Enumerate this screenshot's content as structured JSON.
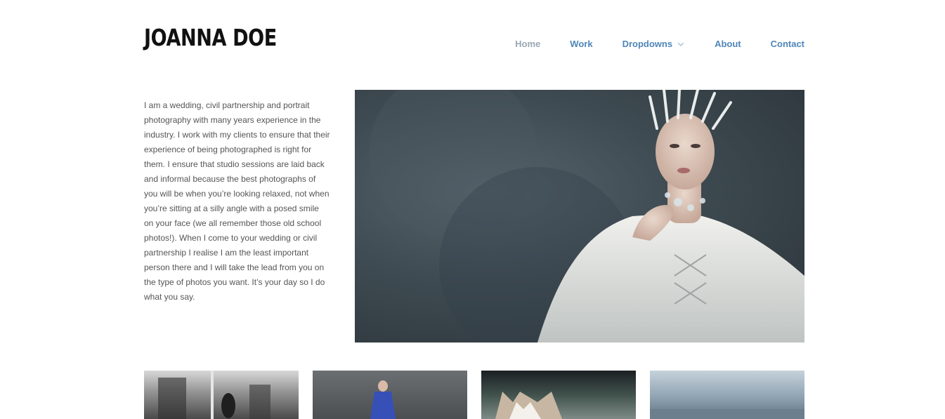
{
  "site": {
    "logo": "JOANNA DOE"
  },
  "nav": {
    "items": [
      {
        "label": "Home"
      },
      {
        "label": "Work"
      },
      {
        "label": "Dropdowns"
      },
      {
        "label": "About"
      },
      {
        "label": "Contact"
      }
    ]
  },
  "bio": {
    "text": "I am a wedding, civil partnership and portrait photography with many years experience in the industry. I work with my clients to ensure that their experience of being photographed is right for them. I ensure that studio sessions are laid back and informal because the best photographs of you will be when you’re looking relaxed, not when you’re sitting at a silly angle with a posed smile on your face (we all remember those old school photos!). When I come to your wedding or civil partnership I realise I am the least important person there and I will take the lead from you on the type of photos you want. It’s your day so I do what you say."
  },
  "colors": {
    "nav_link": "#4f86b8",
    "nav_active": "#9aa7b2",
    "text": "#555555",
    "logo": "#111111"
  },
  "icons": {
    "dropdown_indicator": "chevron-down-icon"
  }
}
